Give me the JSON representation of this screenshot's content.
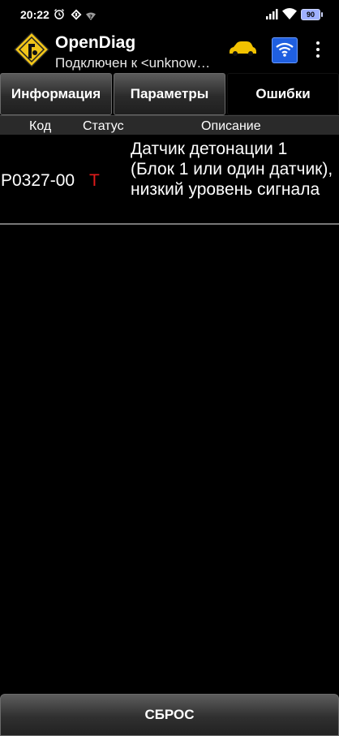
{
  "status_bar": {
    "time": "20:22",
    "battery_level": "90",
    "icons": [
      "alarm-icon",
      "app-notification-icon",
      "wifi-question-icon",
      "cellular-signal-icon",
      "wifi-icon",
      "battery-icon"
    ]
  },
  "app_bar": {
    "title": "OpenDiag",
    "subtitle": "Подключен к <unknow…",
    "icons": [
      "app-logo-icon",
      "car-icon",
      "wifi-connection-icon",
      "more-vertical-icon"
    ]
  },
  "tabs": [
    {
      "label": "Информация",
      "active": false
    },
    {
      "label": "Параметры",
      "active": false
    },
    {
      "label": "Ошибки",
      "active": true
    }
  ],
  "table": {
    "columns": [
      "Код",
      "Статус",
      "Описание"
    ],
    "rows": [
      {
        "code": "P0327-00",
        "status": "T",
        "description": "Датчик детонации 1 (Блок 1 или один датчик), низкий уровень сигнала"
      }
    ]
  },
  "footer": {
    "reset_label": "СБРОС"
  },
  "colors": {
    "background": "#000000",
    "status_red": "#e21b1b",
    "wifi_button_blue": "#1f5fe0",
    "car_yellow": "#f2c200"
  }
}
